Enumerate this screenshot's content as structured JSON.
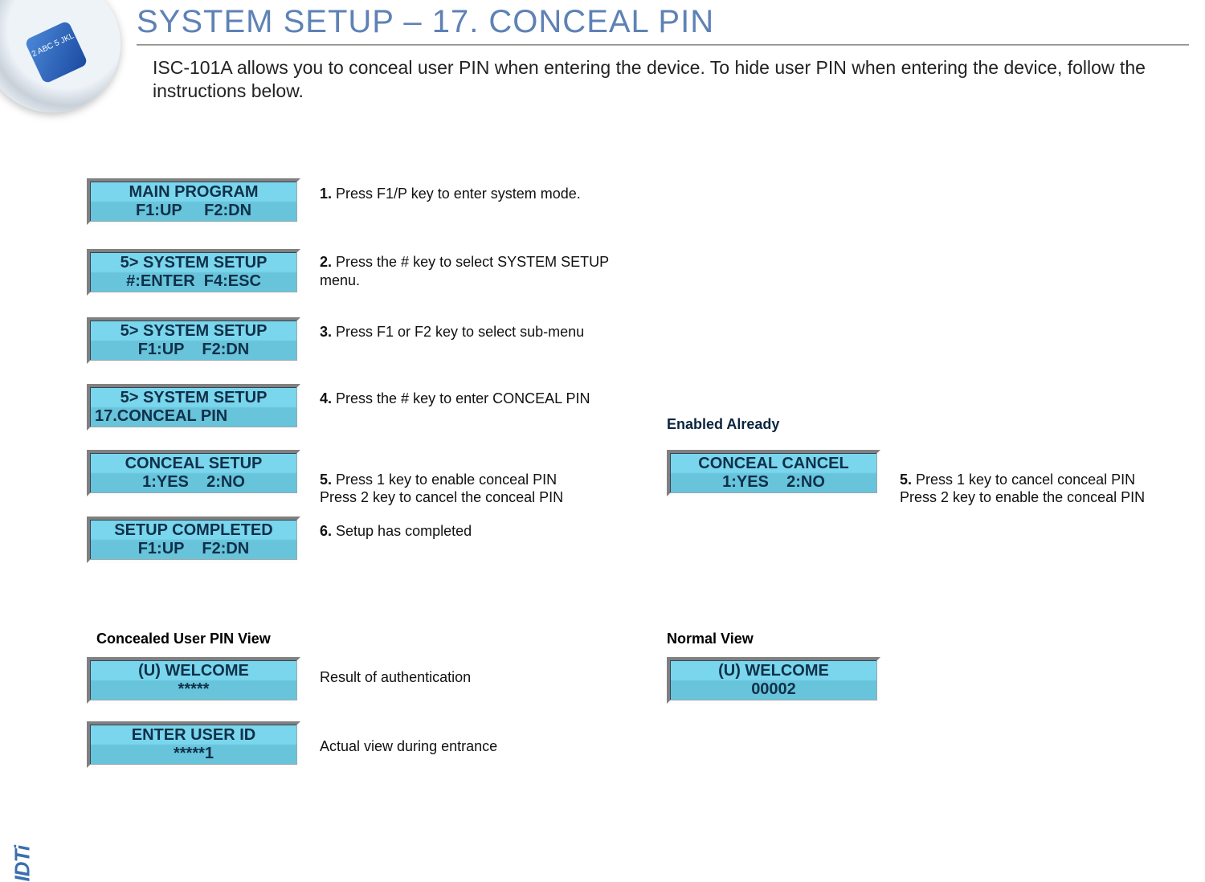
{
  "title": "SYSTEM SETUP – 17. CONCEAL PIN",
  "intro": "ISC-101A allows you to conceal user PIN when entering the device. To hide user PIN when entering the device, follow the instructions below.",
  "logo_text": "2 ABC\n5 JKL",
  "steps": {
    "s1": {
      "lcd_line1": "MAIN PROGRAM",
      "lcd_line2": "F1:UP     F2:DN",
      "num": "1.",
      "text": " Press F1/P key to enter system mode."
    },
    "s2": {
      "lcd_line1": "5> SYSTEM SETUP",
      "lcd_line2": "#:ENTER  F4:ESC",
      "num": "2.",
      "text": " Press the # key to select  SYSTEM SETUP menu."
    },
    "s3": {
      "lcd_line1": "5> SYSTEM SETUP",
      "lcd_line2": "F1:UP    F2:DN",
      "num": "3.",
      "text": " Press F1 or F2  key to select sub-menu"
    },
    "s4": {
      "lcd_line1": "5> SYSTEM SETUP",
      "lcd_line2": "17.CONCEAL PIN",
      "num": "4.",
      "text_a": " Press the # key to enter ",
      "text_b": "CONCEAL PIN"
    },
    "s5": {
      "lcd_line1": "CONCEAL SETUP",
      "lcd_line2": "1:YES    2:NO",
      "num": "5.",
      "text": " Press 1 key to enable conceal PIN\nPress 2 key to cancel the conceal PIN"
    },
    "s6": {
      "lcd_line1": "SETUP COMPLETED",
      "lcd_line2": "F1:UP    F2:DN",
      "num": "6.",
      "text": " Setup has completed"
    }
  },
  "enabled_heading": "Enabled Already",
  "enabled_step": {
    "lcd_line1": "CONCEAL CANCEL",
    "lcd_line2": "1:YES    2:NO",
    "num": "5.",
    "text": " Press 1 key to cancel conceal PIN\nPress 2 key to enable the conceal PIN"
  },
  "concealed_heading": "Concealed User PIN View",
  "normal_heading": "Normal View",
  "concealed": {
    "a": {
      "lcd_line1": "(U) WELCOME",
      "lcd_line2": "*****",
      "caption": "Result of authentication"
    },
    "b": {
      "lcd_line1": "ENTER USER ID",
      "lcd_line2": "*****1",
      "caption": "Actual view during entrance"
    }
  },
  "normal": {
    "lcd_line1": "(U) WELCOME",
    "lcd_line2": "00002"
  },
  "footer_logo": "IDTi"
}
